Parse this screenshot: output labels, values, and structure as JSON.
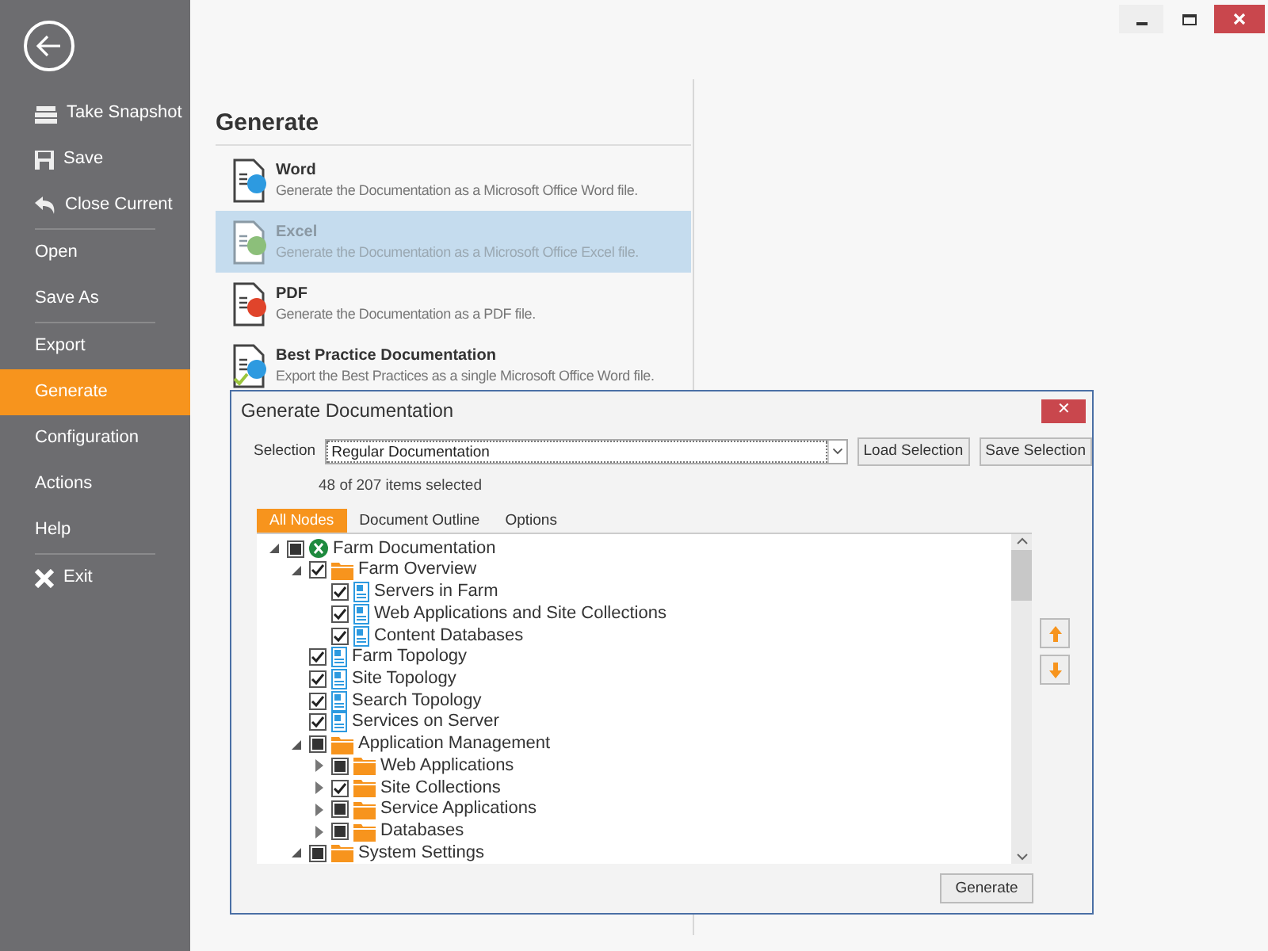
{
  "sidebar": {
    "items": [
      {
        "label": "Take Snapshot",
        "kind": "snapshot",
        "selected": false,
        "separator_after": false
      },
      {
        "label": "Save",
        "kind": "save",
        "selected": false,
        "separator_after": false
      },
      {
        "label": "Close Current",
        "kind": "undo",
        "selected": false,
        "separator_after": true
      },
      {
        "label": "Open",
        "selected": false,
        "separator_after": false
      },
      {
        "label": "Save As",
        "selected": false,
        "separator_after": true
      },
      {
        "label": "Export",
        "selected": false,
        "separator_after": false
      },
      {
        "label": "Generate",
        "selected": true,
        "separator_after": false
      },
      {
        "label": "Configuration",
        "selected": false,
        "separator_after": false
      },
      {
        "label": "Actions",
        "selected": false,
        "separator_after": false
      },
      {
        "label": "Help",
        "selected": false,
        "separator_after": true
      },
      {
        "label": "Exit",
        "kind": "exit",
        "selected": false,
        "separator_after": false
      }
    ]
  },
  "heading": "Generate",
  "options": [
    {
      "title": "Word",
      "description": "Generate the Documentation as a Microsoft Office Word file.",
      "kind": "word",
      "selected": false
    },
    {
      "title": "Excel",
      "description": "Generate the Documentation as a Microsoft Office Excel file.",
      "kind": "excel",
      "selected": true
    },
    {
      "title": "PDF",
      "description": "Generate the Documentation as a PDF file.",
      "kind": "pdf",
      "selected": false
    },
    {
      "title": "Best Practice Documentation",
      "description": "Export the Best Practices as a single Microsoft Office Word file.",
      "kind": "bestpractice",
      "selected": false
    }
  ],
  "dialog": {
    "title": "Generate Documentation",
    "close": "✕",
    "selection_label": "Selection",
    "selection_value": "Regular Documentation",
    "buttons": [
      "Load Selection",
      "Save Selection"
    ],
    "count": "48 of 207 items selected",
    "tabs": [
      {
        "label": "All Nodes",
        "selected": true
      },
      {
        "label": "Document Outline",
        "selected": false
      },
      {
        "label": "Options",
        "selected": false
      }
    ],
    "tree": [
      {
        "label": "Farm Documentation",
        "kind": "excel",
        "checked": false,
        "partial": true,
        "expanded": true,
        "children": [
          {
            "label": "Farm Overview",
            "kind": "folder",
            "checked": true,
            "partial": false,
            "expanded": true,
            "children": [
              {
                "label": "Servers in Farm",
                "kind": "page",
                "checked": true,
                "partial": false
              },
              {
                "label": "Web Applications and Site Collections",
                "kind": "page",
                "checked": true,
                "partial": false
              },
              {
                "label": "Content Databases",
                "kind": "page",
                "checked": true,
                "partial": false
              }
            ]
          },
          {
            "label": "Farm Topology",
            "kind": "page",
            "checked": true,
            "partial": false
          },
          {
            "label": "Site Topology",
            "kind": "page",
            "checked": true,
            "partial": false
          },
          {
            "label": "Search Topology",
            "kind": "page",
            "checked": true,
            "partial": false
          },
          {
            "label": "Services on Server",
            "kind": "page",
            "checked": true,
            "partial": false
          },
          {
            "label": "Application Management",
            "kind": "folder",
            "checked": false,
            "partial": true,
            "expanded": true,
            "children": [
              {
                "label": "Web Applications",
                "kind": "folder",
                "checked": false,
                "partial": true,
                "expanded": false
              },
              {
                "label": "Site Collections",
                "kind": "folder",
                "checked": true,
                "partial": false,
                "expanded": false
              },
              {
                "label": "Service Applications",
                "kind": "folder",
                "checked": false,
                "partial": true,
                "expanded": false
              },
              {
                "label": "Databases",
                "kind": "folder",
                "checked": false,
                "partial": true,
                "expanded": false
              }
            ]
          },
          {
            "label": "System Settings",
            "kind": "folder",
            "checked": false,
            "partial": true,
            "expanded": true
          }
        ]
      }
    ],
    "generate_button": "Generate"
  }
}
